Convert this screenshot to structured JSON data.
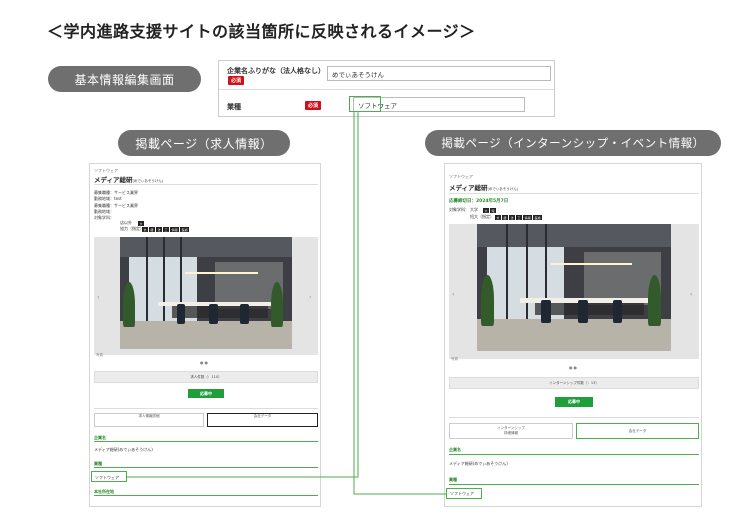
{
  "page_title": "＜学内進路支援サイトの該当箇所に反映されるイメージ＞",
  "labels": {
    "basic_edit": "基本情報編集画面",
    "job_page": "掲載ページ（求人情報）",
    "intern_page": "掲載ページ（インターンシップ・イベント情報）"
  },
  "form": {
    "furigana_label": "企業名ふりがな（法人格なし）",
    "furigana_required": "必須",
    "furigana_value": "めでぃあそうけん",
    "industry_label": "業種",
    "industry_required": "必須",
    "industry_value": "ソフトウェア"
  },
  "job": {
    "category": "ソフトウェア",
    "company": "メディア総研",
    "company_kana": "(めでぃあそうけん)",
    "info_lines": [
      "募集職種：サービス業界",
      "勤務地域：test",
      "募集職種：サービス業界",
      "勤務地域：",
      "対象学科："
    ],
    "target_school": "店以外",
    "target_faculty": "協力（指定）",
    "caption": "写真",
    "count_box": "求人件数（：110）",
    "apply": "応募中",
    "tab1": "求人情報詳細",
    "tab2": "会社データ",
    "section_company": "企業名",
    "company_full": "メディア総研(めでぃあそうけん)",
    "section_industry": "業種",
    "industry_value": "ソフトウェア",
    "section_address": "本社所在地"
  },
  "intern": {
    "category": "ソフトウェア",
    "company": "メディア総研",
    "company_kana": "(めでぃあそうけん)",
    "deadline": "応募締切日：2024年5月7日",
    "target_label": "対象学科：",
    "target_school": "大学",
    "target_faculty": "短大（指定）",
    "caption": "写真",
    "count_box": "インターンシップ件数（：13）",
    "apply": "応募中",
    "tab1a": "インターンシップ",
    "tab1b": "詳細情報",
    "tab2": "会社データ",
    "section_company": "企業名",
    "company_full": "メディア総研(めでぃあそうけん)",
    "section_industry": "業種",
    "industry_value": "ソフトウェア"
  },
  "tags": {
    "school": [
      "大",
      "短"
    ],
    "faculty": [
      "文",
      "経",
      "法",
      "工",
      "情報",
      "医療"
    ]
  },
  "icons": [
    "chevron-left-icon",
    "chevron-right-icon"
  ],
  "colors": {
    "accent_green": "#4cae4c",
    "required_red": "#d0101b",
    "pill_grey": "#6f6f6f",
    "apply_green": "#1f9e3a"
  }
}
